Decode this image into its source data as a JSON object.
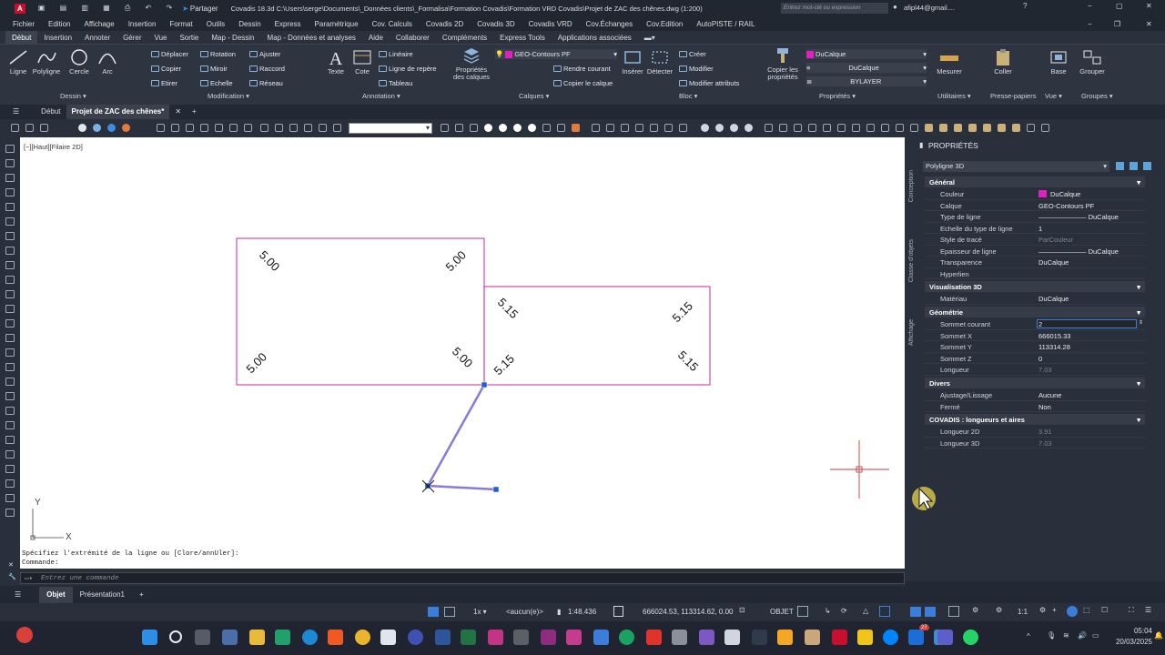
{
  "titlebar": {
    "app_badge": "A",
    "share_label": "Partager",
    "title": "Covadis 18.3d    C:\\Users\\serge\\Documents\\_Données clients\\_Formalisa\\Formation Covadis\\Formation VRD Covadis\\Projet de ZAC des chênes.dwg (1:200)",
    "search_placeholder": "Entrez mot-clé ou expression",
    "user": "afipl44@gmail...."
  },
  "menubar": [
    "Fichier",
    "Edition",
    "Affichage",
    "Insertion",
    "Format",
    "Outils",
    "Dessin",
    "Express",
    "Paramétrique",
    "Cov. Calculs",
    "Covadis 2D",
    "Covadis 3D",
    "Covadis VRD",
    "Cov.Échanges",
    "Cov.Edition",
    "AutoPISTE / RAIL"
  ],
  "ribbon_tabs": [
    "Début",
    "Insertion",
    "Annoter",
    "Gérer",
    "Vue",
    "Sortie",
    "Map - Dessin",
    "Map - Données et analyses",
    "Aide",
    "Collaborer",
    "Compléments",
    "Express Tools",
    "Applications associées"
  ],
  "ribbon": {
    "dessin": {
      "ligne": "Ligne",
      "polyligne": "Polyligne",
      "cercle": "Cercle",
      "arc": "Arc",
      "panel": "Dessin ▾"
    },
    "modification": {
      "deplacer": "Déplacer",
      "rotation": "Rotation",
      "ajuster": "Ajuster",
      "copier": "Copier",
      "miroir": "Miroir",
      "raccord": "Raccord",
      "etirer": "Etirer",
      "echelle": "Echelle",
      "reseau": "Réseau",
      "panel": "Modification ▾"
    },
    "annotation": {
      "texte": "Texte",
      "cote": "Cote",
      "lineaire": "Linéaire",
      "ligne_repere": "Ligne de repère",
      "tableau": "Tableau",
      "panel": "Annotation ▾"
    },
    "calques": {
      "proprietes": "Propriétés des calques",
      "current_layer": "GEO-Contours PF",
      "rendre_courant": "Rendre courant",
      "copier_calque": "Copier le calque",
      "panel": "Calques ▾"
    },
    "bloc": {
      "inserer": "Insérer",
      "detecter": "Détecter",
      "creer": "Créer",
      "modifier": "Modifier",
      "modifier_attributs": "Modifier attributs",
      "panel": "Bloc ▾"
    },
    "proprietes": {
      "copier": "Copier les propriétés",
      "color": "DuCalque",
      "linetype": "DuCalque",
      "lineweight": "BYLAYER",
      "panel": "Propriétés ▾"
    },
    "utilitaires": {
      "mesurer": "Mesurer",
      "panel": "Utilitaires ▾"
    },
    "pressepapiers": {
      "coller": "Coller",
      "panel": "Presse-papiers"
    },
    "vue": {
      "base": "Base",
      "panel": "Vue ▾"
    },
    "groupes": {
      "grouper": "Grouper",
      "panel": "Groupes ▾"
    }
  },
  "doc_tabs": [
    "Début",
    "Projet de ZAC des chênes*"
  ],
  "viewport_label": "[−][Haut][Filaire 2D]",
  "drawing": {
    "labels": [
      "5.00",
      "5.00",
      "5.00",
      "5.00",
      "5.15",
      "5.15",
      "5.15",
      "5.15"
    ],
    "ucs_x": "X",
    "ucs_y": "Y"
  },
  "properties": {
    "header": "PROPRIÉTÉS",
    "side_tabs": [
      "Conception",
      "Classe d'objets",
      "Affichage"
    ],
    "object_type": "Polyligne 3D",
    "sections": [
      {
        "title": "Général",
        "rows": [
          {
            "label": "Couleur",
            "value": "DuCalque"
          },
          {
            "label": "Calque",
            "value": "GEO-Contours PF"
          },
          {
            "label": "Type de ligne",
            "value": "——————— DuCalque"
          },
          {
            "label": "Echelle du type de ligne",
            "value": "1"
          },
          {
            "label": "Style de tracé",
            "value": "ParCouleur"
          },
          {
            "label": "Epaisseur de ligne",
            "value": "——————— DuCalque"
          },
          {
            "label": "Transparence",
            "value": "DuCalque"
          },
          {
            "label": "Hyperlien",
            "value": ""
          }
        ]
      },
      {
        "title": "Visualisation 3D",
        "rows": [
          {
            "label": "Matériau",
            "value": "DuCalque"
          }
        ]
      },
      {
        "title": "Géométrie",
        "rows": [
          {
            "label": "Sommet courant",
            "value": "2"
          },
          {
            "label": "Sommet X",
            "value": "666015.33"
          },
          {
            "label": "Sommet Y",
            "value": "113314.28"
          },
          {
            "label": "Sommet Z",
            "value": "0"
          },
          {
            "label": "Longueur",
            "value": "7.03"
          }
        ]
      },
      {
        "title": "Divers",
        "rows": [
          {
            "label": "Ajustage/Lissage",
            "value": "Aucune"
          },
          {
            "label": "Fermé",
            "value": "Non"
          }
        ]
      },
      {
        "title": "COVADIS : longueurs et aires",
        "rows": [
          {
            "label": "Longueur 2D",
            "value": "3.91"
          },
          {
            "label": "Longueur 3D",
            "value": "7.03"
          }
        ]
      }
    ]
  },
  "command": {
    "history1": "Spécifiez l'extrémité de la ligne ou [Clore/annUler]:",
    "history2": "Commande:",
    "placeholder": "Entrez une commande"
  },
  "layout_tabs": [
    "Objet",
    "Présentation1"
  ],
  "status": {
    "scale": "1:48.436",
    "annot_scale": "<aucun(e)>",
    "coords": "666024.53, 113314.62, 0.00",
    "objet": "OBJET",
    "ratio": "1:1"
  },
  "taskbar": {
    "time": "05:04",
    "date": "20/03/2025",
    "badge": "27"
  },
  "colors": {
    "accent": "#c0168c",
    "selection": "#2f6bd6",
    "polyline": "#8c78d8",
    "grip": "#1f5fd6"
  }
}
